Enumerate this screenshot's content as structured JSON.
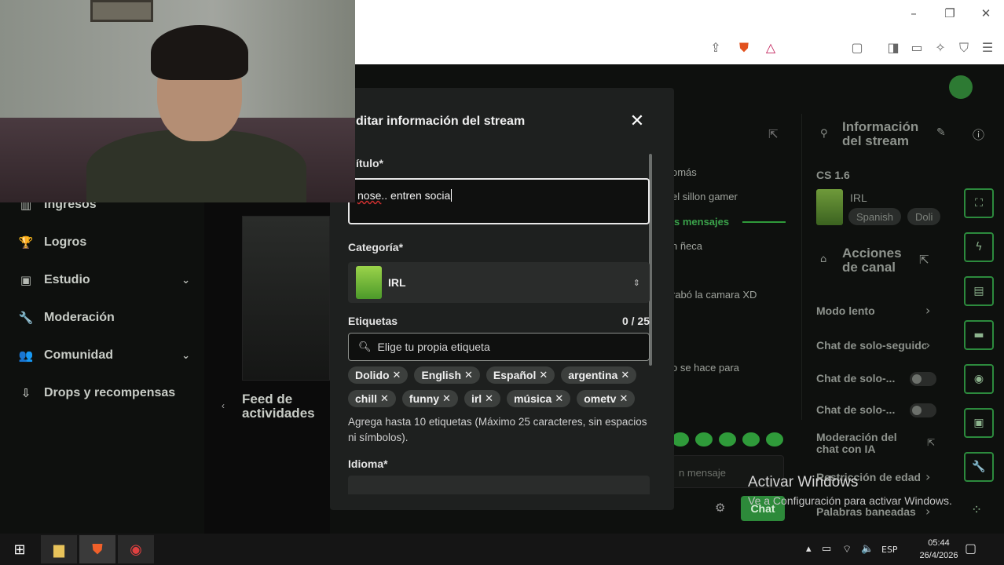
{
  "browser": {
    "controls": [
      "–",
      "❐",
      "✕"
    ],
    "toolbar_icons": [
      "share-icon",
      "brave-shield-icon",
      "brave-rewards-icon",
      "reader-icon",
      "sidebar-icon",
      "wallet-icon",
      "leo-icon",
      "vpn-icon",
      "menu-icon"
    ]
  },
  "nav": {
    "items": [
      {
        "label": "Ingresos",
        "icon": "▥"
      },
      {
        "label": "Logros",
        "icon": "🏆"
      },
      {
        "label": "Estudio",
        "icon": "▣",
        "chevron": "⌄"
      },
      {
        "label": "Moderación",
        "icon": "🔧"
      },
      {
        "label": "Comunidad",
        "icon": "👥",
        "chevron": "⌄"
      },
      {
        "label": "Drops y recompensas",
        "icon": "⇩"
      }
    ]
  },
  "feed": {
    "title": "Feed de actividades"
  },
  "modal": {
    "title": "ditar información del stream",
    "close": "✕",
    "title_label": "ítulo*",
    "title_value_spell": "nose",
    "title_value_rest": ".. entren socia",
    "category_label": "Categoría*",
    "category_value": "IRL",
    "tags_label": "Etiquetas",
    "tags_counter": "0 / 25",
    "tag_placeholder": "Elige tu propia etiqueta",
    "tags": [
      "Dolido",
      "English",
      "Español",
      "argentina",
      "chill",
      "funny",
      "irl",
      "música",
      "ometv"
    ],
    "hint": "Agrega hasta 10 etiquetas (Máximo 25 caracteres, sin espacios ni símbolos).",
    "language_label": "Idioma*"
  },
  "chat": {
    "lines": [
      "omás",
      "el sillon gamer",
      "s mensajes",
      "n ñeca",
      "rabó la camara XD",
      "o se hace para"
    ],
    "placeholder": "n mensaje",
    "send": "Chat"
  },
  "right_panel": {
    "info_title": "Información del stream",
    "game": "CS 1.6",
    "category": "IRL",
    "pills": [
      "Spanish",
      "Doli"
    ],
    "actions_title": "Acciones de canal",
    "items": [
      "Modo lento",
      "Chat de solo-seguidores",
      "Chat de solo-...",
      "Chat de solo-...",
      "Moderación del chat con IA",
      "Restricción de edad",
      "Palabras baneadas"
    ]
  },
  "watermark": {
    "line1": "Activar Windows",
    "line2": "Ve a Configuración para activar Windows."
  },
  "taskbar": {
    "lang": "ESP",
    "time": "05:44",
    "date": "26/4/2026"
  }
}
